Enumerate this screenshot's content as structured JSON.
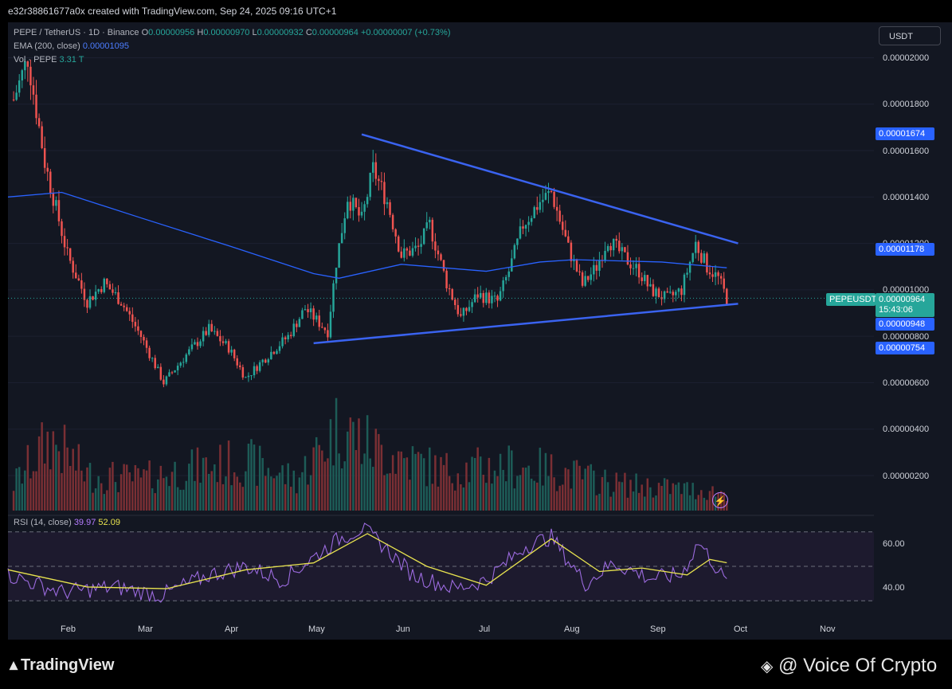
{
  "header": {
    "attribution": "e32r38861677a0x created with TradingView.com, Sep 24, 2025 09:16 UTC+1"
  },
  "legend": {
    "symbol": "PEPE / TetherUS · 1D · Binance",
    "o_label": "O",
    "o_value": "0.00000956",
    "h_label": "H",
    "h_value": "0.00000970",
    "l_label": "L",
    "l_value": "0.00000932",
    "c_label": "C",
    "c_value": "0.00000964",
    "change": "+0.00000007 (+0.73%)",
    "ema_label": "EMA (200, close)",
    "ema_value": "0.00001095",
    "vol_label": "Vol · PEPE",
    "vol_value": "3.31 T",
    "rsi_label": "RSI (14, close)",
    "rsi_value": "39.97",
    "rsi_ma_value": "52.09"
  },
  "currency_button": "USDT",
  "price_axis": [
    "0.00002000",
    "0.00001800",
    "0.00001600",
    "0.00001400",
    "0.00001200",
    "0.00001000",
    "0.00000800",
    "0.00000600",
    "0.00000400",
    "0.00000200"
  ],
  "price_tags": {
    "t1674": "0.00001674",
    "t1178": "0.00001178",
    "symbol_tag": "PEPEUSDT",
    "last": "0.00000964",
    "countdown": "15:43:06",
    "t948": "0.00000948",
    "t754": "0.00000754"
  },
  "rsi_axis": [
    "60.00",
    "40.00"
  ],
  "months": [
    "Feb",
    "Mar",
    "Apr",
    "May",
    "Jun",
    "Jul",
    "Aug",
    "Sep",
    "Oct",
    "Nov"
  ],
  "footer": {
    "brand": "TradingView",
    "watermark": "@ Voice Of Crypto"
  },
  "colors": {
    "up": "#26a69a",
    "down": "#ef5350",
    "ema": "#2962ff",
    "trendline": "#3a63f0",
    "rsi": "#9c6bdf",
    "rsi_ma": "#e8e34f"
  },
  "chart_data": {
    "type": "candlestick",
    "symbol": "PEPE / TetherUS",
    "interval": "1D",
    "x_range": [
      "2025-01-13",
      "2025-11-15"
    ],
    "y_range": [
      0,
      2.15e-05
    ],
    "price_path": [
      [
        "2025-01-15",
        1.82e-05
      ],
      [
        "2025-01-20",
        2e-05
      ],
      [
        "2025-01-26",
        1.55e-05
      ],
      [
        "2025-02-03",
        1.15e-05
      ],
      [
        "2025-02-10",
        9.5e-06
      ],
      [
        "2025-02-16",
        1.03e-05
      ],
      [
        "2025-02-22",
        9.5e-06
      ],
      [
        "2025-03-01",
        8e-06
      ],
      [
        "2025-03-09",
        6e-06
      ],
      [
        "2025-03-17",
        7.2e-06
      ],
      [
        "2025-03-25",
        8.3e-06
      ],
      [
        "2025-04-01",
        7.5e-06
      ],
      [
        "2025-04-07",
        6.2e-06
      ],
      [
        "2025-04-15",
        7.2e-06
      ],
      [
        "2025-04-22",
        8e-06
      ],
      [
        "2025-04-28",
        9.2e-06
      ],
      [
        "2025-05-06",
        8.2e-06
      ],
      [
        "2025-05-09",
        1.12e-05
      ],
      [
        "2025-05-13",
        1.4e-05
      ],
      [
        "2025-05-18",
        1.3e-05
      ],
      [
        "2025-05-22",
        1.52e-05
      ],
      [
        "2025-05-27",
        1.38e-05
      ],
      [
        "2025-06-01",
        1.15e-05
      ],
      [
        "2025-06-07",
        1.18e-05
      ],
      [
        "2025-06-11",
        1.28e-05
      ],
      [
        "2025-06-17",
        1.03e-05
      ],
      [
        "2025-06-22",
        8.8e-06
      ],
      [
        "2025-06-28",
        9.8e-06
      ],
      [
        "2025-07-05",
        9.5e-06
      ],
      [
        "2025-07-09",
        1.08e-05
      ],
      [
        "2025-07-14",
        1.28e-05
      ],
      [
        "2025-07-20",
        1.38e-05
      ],
      [
        "2025-07-24",
        1.42e-05
      ],
      [
        "2025-07-30",
        1.18e-05
      ],
      [
        "2025-08-04",
        1.02e-05
      ],
      [
        "2025-08-09",
        1.1e-05
      ],
      [
        "2025-08-13",
        1.22e-05
      ],
      [
        "2025-08-18",
        1.15e-05
      ],
      [
        "2025-08-24",
        1.08e-05
      ],
      [
        "2025-08-28",
        1e-05
      ],
      [
        "2025-09-03",
        9.6e-06
      ],
      [
        "2025-09-08",
        1e-05
      ],
      [
        "2025-09-13",
        1.2e-05
      ],
      [
        "2025-09-17",
        1.1e-05
      ],
      [
        "2025-09-21",
        1.05e-05
      ],
      [
        "2025-09-24",
        9.64e-06
      ]
    ],
    "ema_200": [
      [
        "2025-01-13",
        1.4e-05
      ],
      [
        "2025-02-01",
        1.42e-05
      ],
      [
        "2025-03-01",
        1.31e-05
      ],
      [
        "2025-04-01",
        1.19e-05
      ],
      [
        "2025-05-01",
        1.07e-05
      ],
      [
        "2025-05-10",
        1.05e-05
      ],
      [
        "2025-06-01",
        1.11e-05
      ],
      [
        "2025-07-01",
        1.08e-05
      ],
      [
        "2025-07-20",
        1.12e-05
      ],
      [
        "2025-08-01",
        1.13e-05
      ],
      [
        "2025-09-01",
        1.12e-05
      ],
      [
        "2025-09-24",
        1.095e-05
      ]
    ],
    "trendlines": [
      {
        "name": "upper",
        "points": [
          [
            "2025-05-18",
            1.67e-05
          ],
          [
            "2025-09-28",
            1.2e-05
          ]
        ]
      },
      {
        "name": "lower",
        "points": [
          [
            "2025-05-01",
            7.7e-06
          ],
          [
            "2025-09-28",
            9.4e-06
          ]
        ]
      }
    ],
    "volume_profile": [
      [
        "2025-01-15",
        0.3
      ],
      [
        "2025-01-28",
        0.8
      ],
      [
        "2025-02-10",
        0.4
      ],
      [
        "2025-03-01",
        0.35
      ],
      [
        "2025-03-15",
        0.45
      ],
      [
        "2025-04-07",
        0.55
      ],
      [
        "2025-04-25",
        0.35
      ],
      [
        "2025-05-10",
        0.95
      ],
      [
        "2025-05-22",
        0.7
      ],
      [
        "2025-06-15",
        0.45
      ],
      [
        "2025-07-10",
        0.5
      ],
      [
        "2025-07-25",
        0.45
      ],
      [
        "2025-08-15",
        0.3
      ],
      [
        "2025-09-05",
        0.25
      ],
      [
        "2025-09-24",
        0.2
      ]
    ],
    "rsi_path": [
      [
        "2025-01-13",
        45
      ],
      [
        "2025-02-01",
        35
      ],
      [
        "2025-02-20",
        38
      ],
      [
        "2025-03-08",
        33
      ],
      [
        "2025-03-25",
        45
      ],
      [
        "2025-04-07",
        50
      ],
      [
        "2025-04-20",
        42
      ],
      [
        "2025-05-10",
        66
      ],
      [
        "2025-05-18",
        72
      ],
      [
        "2025-05-25",
        63
      ],
      [
        "2025-06-05",
        45
      ],
      [
        "2025-06-20",
        37
      ],
      [
        "2025-07-01",
        42
      ],
      [
        "2025-07-15",
        62
      ],
      [
        "2025-07-24",
        67
      ],
      [
        "2025-08-05",
        40
      ],
      [
        "2025-08-15",
        52
      ],
      [
        "2025-08-28",
        43
      ],
      [
        "2025-09-08",
        45
      ],
      [
        "2025-09-14",
        64
      ],
      [
        "2025-09-18",
        55
      ],
      [
        "2025-09-24",
        39.97
      ]
    ],
    "rsi_ma_path": [
      [
        "2025-01-13",
        48
      ],
      [
        "2025-02-10",
        38
      ],
      [
        "2025-03-10",
        37
      ],
      [
        "2025-04-07",
        48
      ],
      [
        "2025-05-01",
        52
      ],
      [
        "2025-05-20",
        69
      ],
      [
        "2025-06-10",
        50
      ],
      [
        "2025-07-01",
        39
      ],
      [
        "2025-07-24",
        66
      ],
      [
        "2025-08-10",
        47
      ],
      [
        "2025-08-25",
        49
      ],
      [
        "2025-09-10",
        45
      ],
      [
        "2025-09-18",
        54
      ],
      [
        "2025-09-24",
        52.09
      ]
    ],
    "rsi_range": [
      25,
      75
    ],
    "rsi_bands": [
      70,
      50,
      30
    ]
  }
}
